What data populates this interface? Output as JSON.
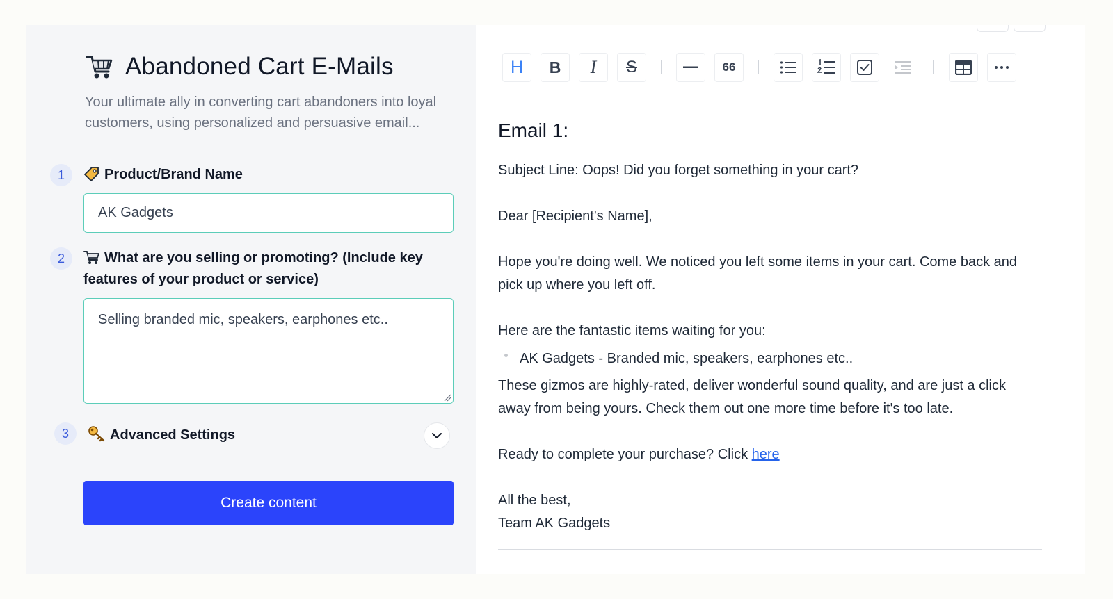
{
  "app": {
    "title": "Abandoned Cart E-Mails",
    "subtitle": "Your ultimate ally in converting cart abandoners into loyal customers, using personalized and persuasive email..."
  },
  "form": {
    "steps": [
      {
        "number": "1",
        "label": "Product/Brand Name",
        "icon": "tag-icon",
        "value": "AK Gadgets"
      },
      {
        "number": "2",
        "label": "What are you selling or promoting? (Include key features of your product or service)",
        "icon": "shopping-cart-icon",
        "value": "Selling branded mic, speakers, earphones etc.."
      },
      {
        "number": "3",
        "label": "Advanced Settings",
        "icon": "key-icon"
      }
    ],
    "create_label": "Create content"
  },
  "toolbar": {
    "heading": "H",
    "bold": "B",
    "italic": "I",
    "strike": "S",
    "quote": "66"
  },
  "document": {
    "heading": "Email 1:",
    "subject": "Subject Line: Oops! Did you forget something in your cart?",
    "greeting": "Dear [Recipient's Name],",
    "intro": "Hope you're doing well. We noticed you left some items in your cart. Come back and pick up where you left off.",
    "items_lead": "Here are the fantastic items waiting for you:",
    "items": [
      "AK Gadgets - Branded mic, speakers, earphones etc.."
    ],
    "body": "These gizmos are highly-rated, deliver wonderful sound quality, and are just a click away from being yours. Check them out one more time before it's too late.",
    "cta_text": "Ready to complete your purchase? Click ",
    "cta_link": "here",
    "signoff": "All the best,",
    "signature": "Team AK Gadgets"
  },
  "colors": {
    "accent": "#2b44fb",
    "field_border": "#5ccdb9",
    "link": "#2563eb",
    "heading_button": "#3b82f6"
  }
}
